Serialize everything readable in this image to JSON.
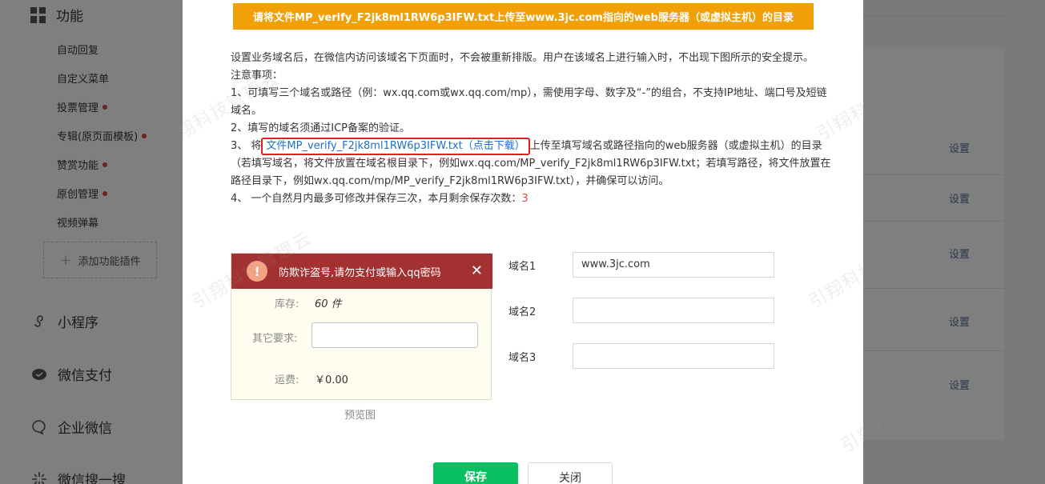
{
  "sidebar": {
    "section_title": "功能",
    "items": [
      {
        "label": "自动回复",
        "dot": false
      },
      {
        "label": "自定义菜单",
        "dot": false
      },
      {
        "label": "投票管理",
        "dot": true
      },
      {
        "label": "专辑(原页面模板)",
        "dot": true
      },
      {
        "label": "赞赏功能",
        "dot": true
      },
      {
        "label": "原创管理",
        "dot": true
      },
      {
        "label": "视频弹幕",
        "dot": false
      }
    ],
    "add_plugin_label": "添加功能插件",
    "sections": [
      "小程序",
      "微信支付",
      "企业微信",
      "微信搜一搜"
    ]
  },
  "right_panel": {
    "set_label": "设置"
  },
  "modal": {
    "banner": "请将文件MP_verify_F2jk8ml1RW6p3IFW.txt上传至www.3jc.com指向的web服务器（或虚拟主机）的目录",
    "desc_line1": "设置业务域名后，在微信内访问该域名下页面时，不会被重新排版。用户在该域名上进行输入时，不出现下图所示的安全提示。",
    "notes_title": "注意事项：",
    "note1": "1、可填写三个域名或路径（例：wx.qq.com或wx.qq.com/mp），需使用字母、数字及“-”的组合，不支持IP地址、端口号及短链域名。",
    "note2": "2、填写的域名须通过ICP备案的验证。",
    "note3_prefix": "3、 将",
    "note3_link": "文件MP_verify_F2jk8ml1RW6p3IFW.txt（点击下载）",
    "note3_suffix": "上传至填写域名或路径指向的web服务器（或虚拟主机）的目录（若填写域名，将文件放置在域名根目录下，例如wx.qq.com/MP_verify_F2jk8ml1RW6p3IFW.txt；若填写路径，将文件放置在路径目录下，例如wx.qq.com/mp/MP_verify_F2jk8ml1RW6p3IFW.txt），并确保可以访问。",
    "note4_prefix": "4、 一个自然月内最多可修改并保存三次，本月剩余保存次数：",
    "note4_count": "3",
    "preview": {
      "warning": "防欺诈盗号,请勿支付或输入qq密码",
      "stock_label": "库存:",
      "stock_value": "60 件",
      "other_label": "其它要求:",
      "shipping_label": "运费:",
      "shipping_value": "￥0.00",
      "caption": "预览图"
    },
    "domains": [
      {
        "label": "域名1",
        "value": "www.3jc.com"
      },
      {
        "label": "域名2",
        "value": ""
      },
      {
        "label": "域名3",
        "value": ""
      }
    ],
    "save_label": "保存",
    "close_label": "关闭"
  },
  "watermark": "引翔科技管理云",
  "colors": {
    "banner": "#f1a007",
    "save": "#07c160",
    "warn_bar": "#a33131",
    "link": "#1e6fc4",
    "highlight_border": "#e02020"
  }
}
